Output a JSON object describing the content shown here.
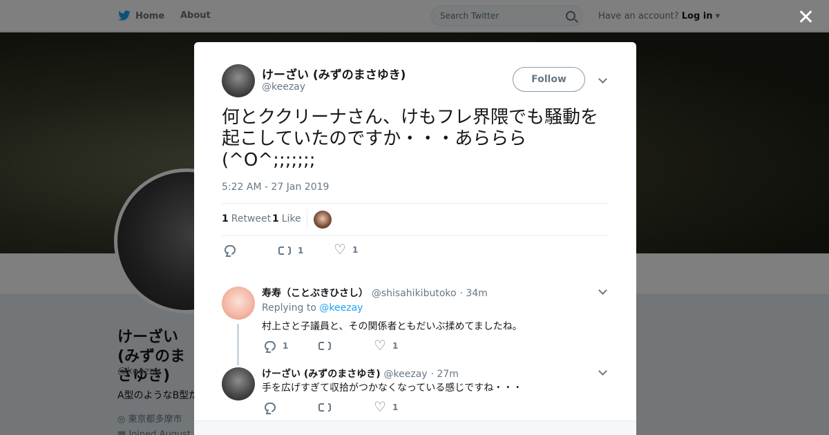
{
  "nav": {
    "home_label": "Home",
    "about_label": "About",
    "search_placeholder": "Search Twitter",
    "account_prompt": "Have an account?",
    "login_label": "Log in"
  },
  "profile": {
    "name": "けーざい (みずのまさゆき)",
    "handle": "@keezay",
    "bio": "A型のようなB型だ",
    "location": "東京都多摩市",
    "joined": "Joined August"
  },
  "tweet": {
    "author_name": "けーざい (みずのまさゆき)",
    "author_handle": "@keezay",
    "follow_label": "Follow",
    "text": "何とククリーナさん、けもフレ界隈でも騒動を起こしていたのですか・・・あららら(^O^;;;;;;;",
    "timestamp": "5:22 AM - 27 Jan 2019",
    "retweet_count": "1",
    "retweet_label": "Retweet",
    "like_count": "1",
    "like_label": "Like",
    "action_retweets": "1",
    "action_likes": "1"
  },
  "replies": [
    {
      "name": "寿寿（ことぶきひさし）",
      "handle": "@shisahikibutoko",
      "time": "· 34m",
      "replying_prefix": "Replying to",
      "replying_to": "@keezay",
      "text": "村上さと子議員と、その関係者ともだいぶ揉めてましたね。",
      "reply_count": "1",
      "like_count": "1"
    },
    {
      "name": "けーざい (みずのまさゆき)",
      "handle": "@keezay",
      "time": "· 27m",
      "text": "手を広げすぎて収拾がつかなくなっている感じですね・・・",
      "like_count": "1"
    }
  ],
  "colors": {
    "accent": "#1da1f2",
    "muted": "#657786",
    "text": "#14171a"
  }
}
